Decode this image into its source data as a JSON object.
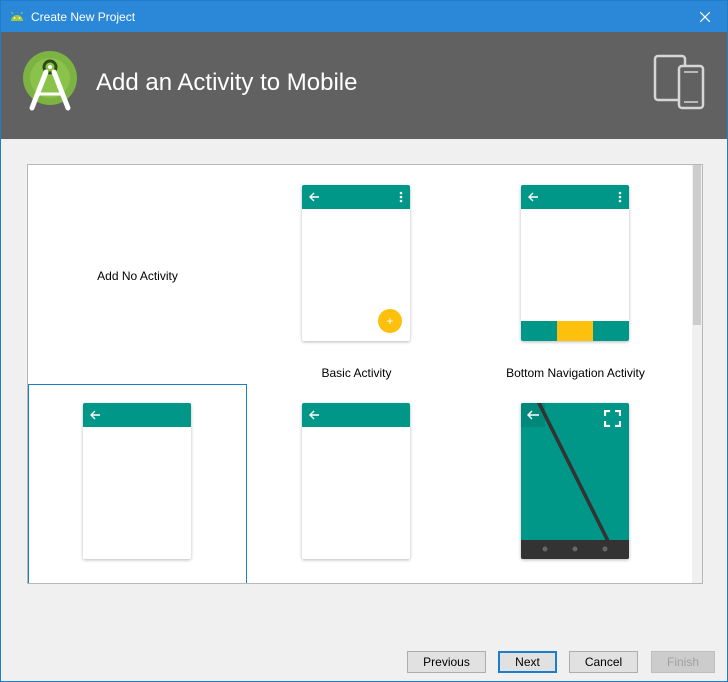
{
  "window": {
    "title": "Create New Project"
  },
  "header": {
    "heading": "Add an Activity to Mobile"
  },
  "gallery": {
    "tiles": [
      {
        "label": "Add No Activity"
      },
      {
        "label": "Basic Activity"
      },
      {
        "label": "Bottom Navigation Activity"
      },
      {
        "label": ""
      },
      {
        "label": ""
      },
      {
        "label": ""
      }
    ],
    "fab_symbol": "+"
  },
  "buttons": {
    "previous": "Previous",
    "next": "Next",
    "cancel": "Cancel",
    "finish": "Finish"
  },
  "colors": {
    "titlebar": "#2b88d8",
    "header": "#616161",
    "teal": "#009688",
    "accent": "#fcc00d",
    "selection": "#1e7dc8"
  },
  "icons": [
    "android-studio-icon",
    "close-icon",
    "android-studio-logo",
    "devices-icon",
    "back-arrow-icon",
    "overflow-menu-icon",
    "fullscreen-icon"
  ]
}
